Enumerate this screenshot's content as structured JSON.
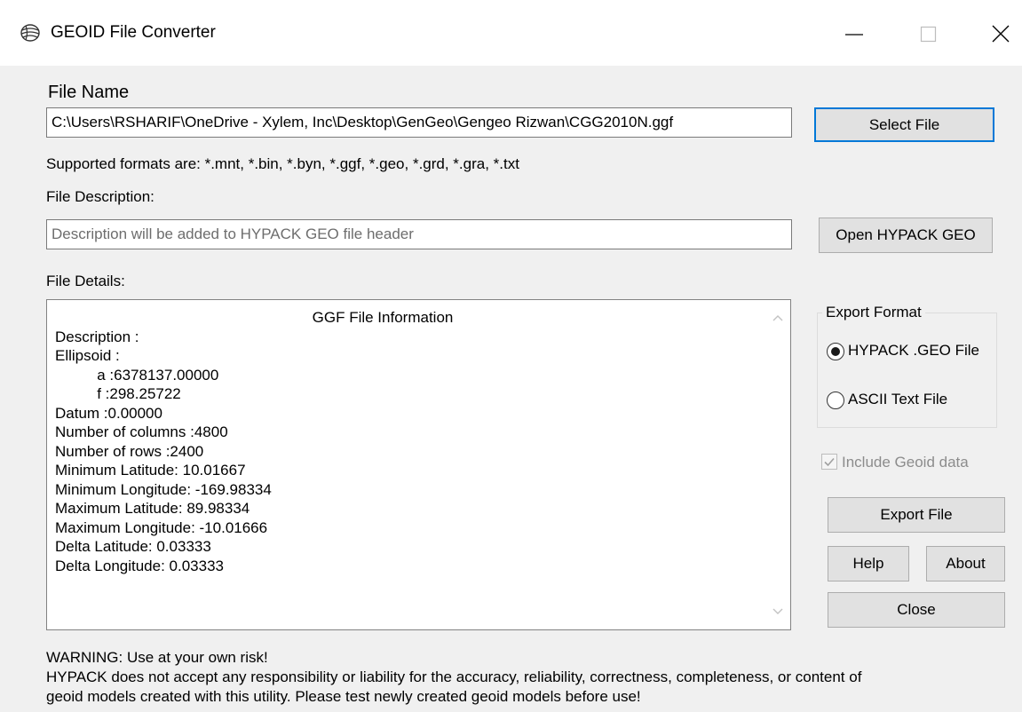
{
  "window": {
    "title": "GEOID File Converter",
    "icon": "geoid-app-icon",
    "controls": [
      "minimize-icon",
      "maximize-icon",
      "close-icon"
    ]
  },
  "file_name": {
    "label": "File Name",
    "value": "C:\\Users\\RSHARIF\\OneDrive - Xylem, Inc\\Desktop\\GenGeo\\Gengeo Rizwan\\CGG2010N.ggf",
    "select_button": "Select File"
  },
  "supported_formats": "Supported formats are: *.mnt, *.bin, *.byn, *.ggf, *.geo, *.grd, *.gra, *.txt",
  "file_description": {
    "label": "File Description:",
    "placeholder": "Description will be added to HYPACK GEO file header",
    "value": "",
    "open_button": "Open HYPACK GEO"
  },
  "file_details": {
    "label": "File Details:",
    "heading": "GGF File Information",
    "lines": [
      "Description :",
      "Ellipsoid :",
      "          a :6378137.00000",
      "          f :298.25722",
      "Datum :0.00000",
      "Number of columns :4800",
      "Number of rows :2400",
      "Minimum Latitude: 10.01667",
      "Minimum Longitude: -169.98334",
      "Maximum Latitude: 89.98334",
      "Maximum Longitude: -10.01666",
      "Delta Latitude: 0.03333",
      "Delta Longitude: 0.03333"
    ]
  },
  "export_format": {
    "title": "Export Format",
    "options": [
      {
        "label": "HYPACK .GEO File",
        "selected": true
      },
      {
        "label": "ASCII Text File",
        "selected": false
      }
    ]
  },
  "include_geoid": {
    "label": "Include Geoid data",
    "checked": true,
    "enabled": false
  },
  "buttons": {
    "export": "Export File",
    "help": "Help",
    "about": "About",
    "close": "Close"
  },
  "warning": [
    "WARNING: Use at your own risk!",
    "HYPACK does not accept any responsibility or liability for the accuracy, reliability, correctness, completeness, or content of",
    "geoid models created with this utility. Please test newly created geoid models before use!"
  ],
  "colors": {
    "focus_border": "#0078d7",
    "button_face": "#e1e1e1",
    "dialog_background": "#f0f0f0"
  }
}
